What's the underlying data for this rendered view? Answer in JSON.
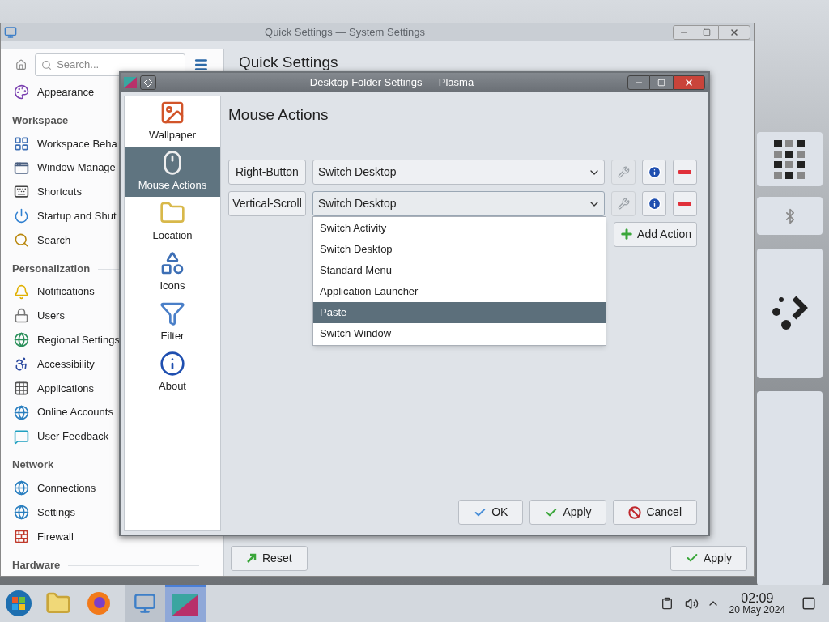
{
  "settings_window": {
    "title": "Quick Settings — System Settings",
    "search": {
      "placeholder": "Search..."
    },
    "sidebar": [
      {
        "kind": "item",
        "label": "Appearance"
      },
      {
        "kind": "header",
        "label": "Workspace"
      },
      {
        "kind": "item",
        "label": "Workspace Beha"
      },
      {
        "kind": "item",
        "label": "Window Manage"
      },
      {
        "kind": "item",
        "label": "Shortcuts"
      },
      {
        "kind": "item",
        "label": "Startup and Shut"
      },
      {
        "kind": "item",
        "label": "Search"
      },
      {
        "kind": "header",
        "label": "Personalization"
      },
      {
        "kind": "item",
        "label": "Notifications"
      },
      {
        "kind": "item",
        "label": "Users"
      },
      {
        "kind": "item",
        "label": "Regional Settings"
      },
      {
        "kind": "item",
        "label": "Accessibility"
      },
      {
        "kind": "item",
        "label": "Applications"
      },
      {
        "kind": "item",
        "label": "Online Accounts"
      },
      {
        "kind": "item",
        "label": "User Feedback"
      },
      {
        "kind": "header",
        "label": "Network"
      },
      {
        "kind": "item",
        "label": "Connections"
      },
      {
        "kind": "item",
        "label": "Settings"
      },
      {
        "kind": "item",
        "label": "Firewall"
      },
      {
        "kind": "header",
        "label": "Hardware"
      }
    ],
    "page_title": "Quick Settings",
    "buttons": [
      {
        "kind": "reset",
        "label": "Reset"
      },
      {
        "kind": "apply",
        "label": "Apply"
      }
    ]
  },
  "dialog": {
    "title": "Desktop Folder Settings — Plasma",
    "categories": [
      {
        "label": "Wallpaper",
        "selected": false
      },
      {
        "label": "Mouse Actions",
        "selected": true
      },
      {
        "label": "Location",
        "selected": false
      },
      {
        "label": "Icons",
        "selected": false
      },
      {
        "label": "Filter",
        "selected": false
      },
      {
        "label": "About",
        "selected": false
      }
    ],
    "heading": "Mouse Actions",
    "actions": [
      {
        "trigger": "Right-Button",
        "plugin": "Switch Desktop",
        "expanded": false
      },
      {
        "trigger": "Vertical-Scroll",
        "plugin": "Switch Desktop",
        "expanded": true
      }
    ],
    "menu": [
      {
        "label": "Switch Activity",
        "selected": false
      },
      {
        "label": "Switch Desktop",
        "selected": false
      },
      {
        "label": "Standard Menu",
        "selected": false
      },
      {
        "label": "Application Launcher",
        "selected": false
      },
      {
        "label": "Paste",
        "selected": true
      },
      {
        "label": "Switch Window",
        "selected": false
      }
    ],
    "add_action": "Add Action",
    "buttons": [
      {
        "kind": "ok",
        "label": "OK"
      },
      {
        "kind": "apply",
        "label": "Apply"
      },
      {
        "kind": "cancel",
        "label": "Cancel"
      }
    ]
  },
  "taskbar": {
    "clock": {
      "time": "02:09",
      "date": "20 May 2024"
    }
  }
}
